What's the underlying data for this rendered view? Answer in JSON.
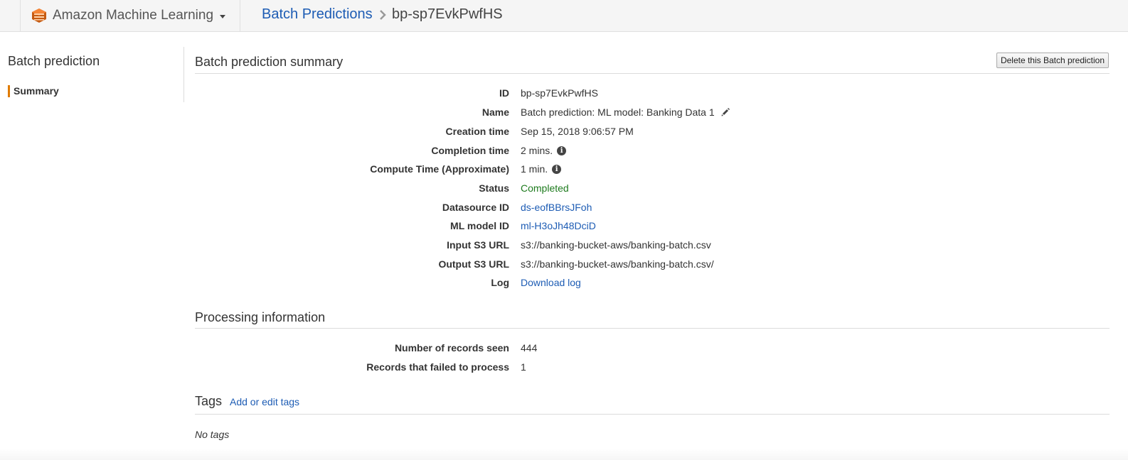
{
  "header": {
    "service_name": "Amazon Machine Learning",
    "service_icon": "aws-machine-learning-icon",
    "breadcrumb_link": "Batch Predictions",
    "breadcrumb_current": "bp-sp7EvkPwfHS"
  },
  "sidebar": {
    "title": "Batch prediction",
    "items": [
      {
        "label": "Summary",
        "active": true
      }
    ]
  },
  "summary": {
    "title": "Batch prediction summary",
    "delete_label": "Delete this Batch prediction",
    "fields": {
      "id": {
        "label": "ID",
        "value": "bp-sp7EvkPwfHS"
      },
      "name": {
        "label": "Name",
        "value": "Batch prediction: ML model: Banking Data 1"
      },
      "creation_time": {
        "label": "Creation time",
        "value": "Sep 15, 2018 9:06:57 PM"
      },
      "completion_time": {
        "label": "Completion time",
        "value": "2 mins."
      },
      "compute_time": {
        "label": "Compute Time (Approximate)",
        "value": "1 min."
      },
      "status": {
        "label": "Status",
        "value": "Completed"
      },
      "datasource_id": {
        "label": "Datasource ID",
        "value": "ds-eofBBrsJFoh"
      },
      "ml_model_id": {
        "label": "ML model ID",
        "value": "ml-H3oJh48DciD"
      },
      "input_s3": {
        "label": "Input S3 URL",
        "value": "s3://banking-bucket-aws/banking-batch.csv"
      },
      "output_s3": {
        "label": "Output S3 URL",
        "value": "s3://banking-bucket-aws/banking-batch.csv/"
      },
      "log": {
        "label": "Log",
        "value": "Download log"
      }
    }
  },
  "processing": {
    "title": "Processing information",
    "records_seen": {
      "label": "Number of records seen",
      "value": "444"
    },
    "records_failed": {
      "label": "Records that failed to process",
      "value": "1"
    }
  },
  "tags": {
    "title": "Tags",
    "edit_label": "Add or edit tags",
    "empty_text": "No tags"
  },
  "colors": {
    "link": "#1d5cb4",
    "status_ok": "#1e7b1e",
    "accent": "#e07b00"
  }
}
